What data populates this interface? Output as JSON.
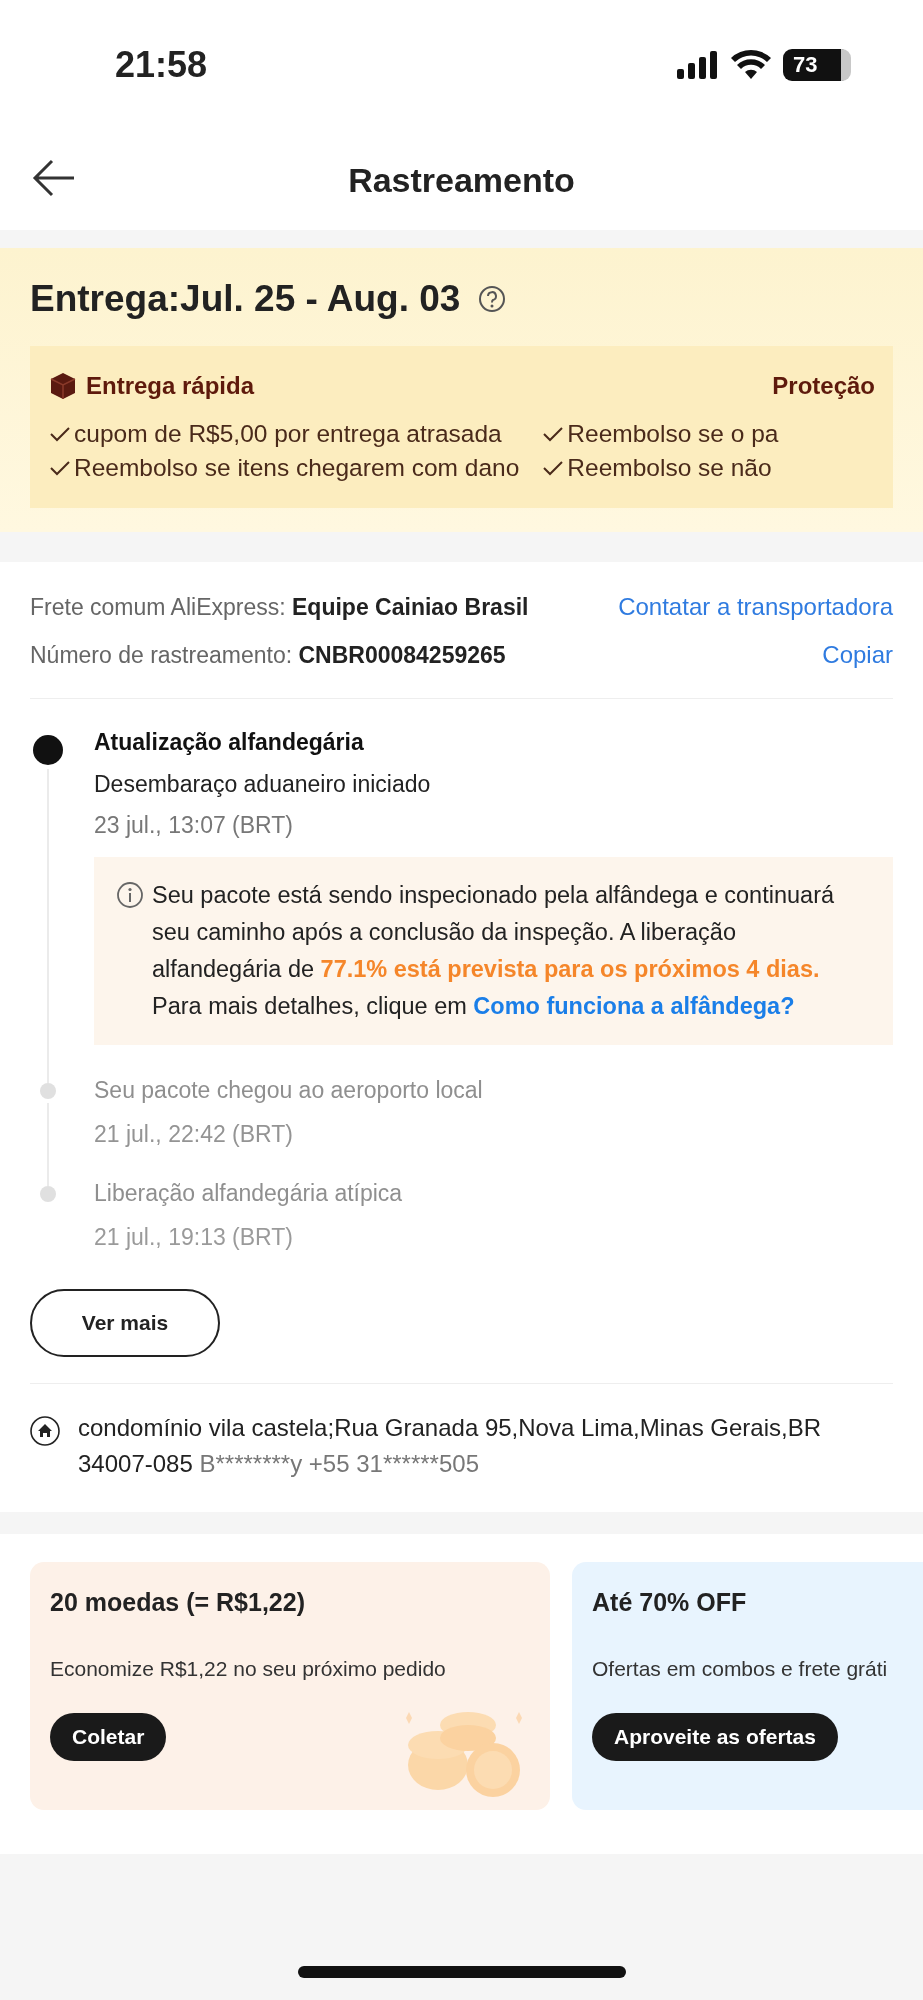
{
  "status_bar": {
    "time": "21:58",
    "battery": "73"
  },
  "header": {
    "title": "Rastreamento"
  },
  "delivery": {
    "title": "Entrega:Jul. 25 - Aug. 03",
    "fast": {
      "title": "Entrega rápida",
      "items": [
        "cupom de R$5,00 por entrega atrasada",
        "Reembolso se itens chegarem com dano"
      ]
    },
    "protection": {
      "title": "Proteção",
      "items": [
        "Reembolso se o pa",
        "Reembolso se não"
      ]
    }
  },
  "shipping": {
    "carrier": "Frete comum AliExpress: **Equipe Cainiao Brasil**",
    "contact_link": "Contatar a transportadora",
    "tracking": "Número de rastreamento: **CNBR00084259265**",
    "copy_link": "Copiar"
  },
  "timeline": [
    {
      "title": "Atualização alfandegária",
      "description": "Desembaraço aduaneiro iniciado",
      "time": "23 jul., 13:07 (BRT)",
      "current": true,
      "note": [
        {
          "kind": "plain",
          "text": "Seu pacote está sendo inspecionado pela alfândega e continuará seu caminho após a conclusão da inspeção. A liberação alfandegária de "
        },
        {
          "kind": "highlight",
          "text": "77.1% está prevista para os próximos 4 dias."
        },
        {
          "kind": "plain",
          "text": " Para mais detalhes, clique em "
        },
        {
          "kind": "link",
          "text": "Como funciona a alfândega?"
        }
      ]
    },
    {
      "title": "Seu pacote chegou ao aeroporto local",
      "time": "21 jul., 22:42 (BRT)",
      "current": false
    },
    {
      "title": "Liberação alfandegária atípica",
      "time": "21 jul., 19:13 (BRT)",
      "current": false
    }
  ],
  "more_button": "Ver mais",
  "address": {
    "text": "condomínio vila castela;Rua Granada 95,Nova Lima,Minas Gerais,BR 34007-085",
    "contact": "B********y +55 31******505"
  },
  "promos": [
    {
      "kind": "coins",
      "title": "20 moedas (= R$1,22)",
      "description": "Economize R$1,22 no seu próximo pedido",
      "button": "Coletar"
    },
    {
      "kind": "deals",
      "title": "Até 70% OFF",
      "description": "Ofertas em combos e frete gráti",
      "button": "Aproveite as ofertas"
    }
  ]
}
